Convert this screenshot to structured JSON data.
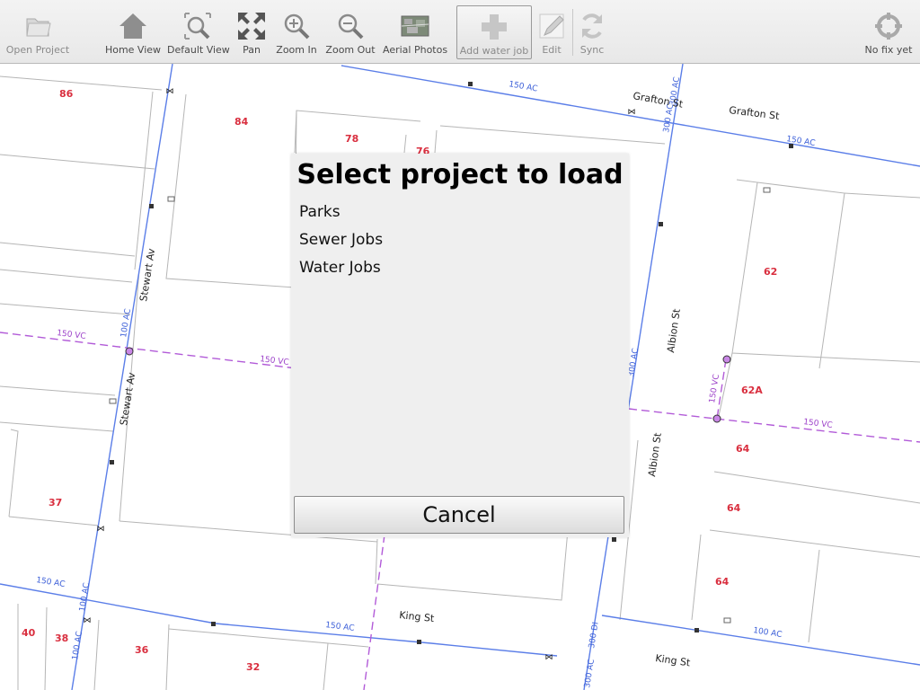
{
  "toolbar": {
    "open_project": "Open Project",
    "home_view": "Home View",
    "default_view": "Default View",
    "pan": "Pan",
    "zoom_in": "Zoom In",
    "zoom_out": "Zoom Out",
    "aerial_photos": "Aerial Photos",
    "add_water_job": "Add water job",
    "edit": "Edit",
    "sync": "Sync",
    "gps_status": "No fix yet"
  },
  "icons": {
    "open_project": "folder-icon",
    "home_view": "home-icon",
    "default_view": "default-view-icon",
    "pan": "pan-arrows-icon",
    "zoom_in": "zoom-in-icon",
    "zoom_out": "zoom-out-icon",
    "aerial_photos": "aerial-photo-icon",
    "add_water_job": "plus-icon",
    "edit": "pencil-icon",
    "sync": "sync-icon",
    "gps": "gps-target-icon"
  },
  "dialog": {
    "title": "Select project to load",
    "projects": [
      "Parks",
      "Sewer Jobs",
      "Water Jobs"
    ],
    "cancel_label": "Cancel"
  },
  "map": {
    "streets": {
      "grafton_top": "Grafton St",
      "grafton": "Grafton St",
      "stewart_1": "Stewart Av",
      "stewart_2": "Stewart Av",
      "albion_1": "Albion St",
      "albion_2": "Albion St",
      "king_1": "King St",
      "king_2": "King St"
    },
    "pipes": {
      "p1": "150 AC",
      "p2": "300 AC",
      "p3": "300 AC",
      "p4": "150 AC",
      "p5": "150 VC",
      "p6": "150 VC",
      "p7": "100 AC",
      "p8": "300 AC",
      "p9": "150 VC",
      "p10": "150 VC",
      "p11": "150 AC",
      "p12": "100 AC",
      "p13": "100 AC",
      "p14": "150 AC",
      "p15": "300 DI",
      "p16": "300 AC",
      "p17": "100 AC"
    },
    "lots": {
      "l86": "86",
      "l84": "84",
      "l78": "78",
      "l76": "76",
      "l62": "62",
      "l62a": "62A",
      "l64a": "64",
      "l64b": "64",
      "l64c": "64",
      "l37": "37",
      "l40": "40",
      "l38": "38",
      "l36": "36",
      "l32": "32"
    },
    "colors": {
      "water_main": "#5b7ee8",
      "sewer_main": "#b25bd8",
      "lot_number": "#d92f3f"
    }
  }
}
